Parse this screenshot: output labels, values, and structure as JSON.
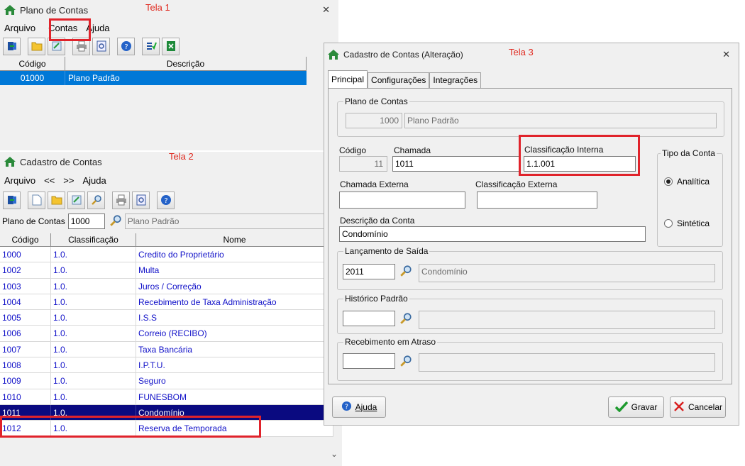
{
  "tela1": {
    "title": "Plano de Contas",
    "label": "Tela 1",
    "close": "✕",
    "menu": [
      "Arquivo",
      "Contas",
      "Ajuda"
    ],
    "columns": [
      "Código",
      "Descrição"
    ],
    "rows": [
      {
        "codigo": "01000",
        "descricao": "Plano Padrão"
      }
    ]
  },
  "tela2": {
    "title": "Cadastro de Contas",
    "label": "Tela 2",
    "menu": [
      "Arquivo",
      "<<",
      ">>",
      "Ajuda"
    ],
    "plano_label": "Plano de Contas",
    "plano_value": "1000",
    "plano_name": "Plano Padrão",
    "columns": [
      "Código",
      "Classificação",
      "Nome"
    ],
    "rows": [
      {
        "codigo": "1000",
        "classificacao": "1.0.",
        "nome": "Credito do Proprietário"
      },
      {
        "codigo": "1002",
        "classificacao": "1.0.",
        "nome": "Multa"
      },
      {
        "codigo": "1003",
        "classificacao": "1.0.",
        "nome": "Juros / Correção"
      },
      {
        "codigo": "1004",
        "classificacao": "1.0.",
        "nome": "Recebimento de Taxa Administração"
      },
      {
        "codigo": "1005",
        "classificacao": "1.0.",
        "nome": "I.S.S"
      },
      {
        "codigo": "1006",
        "classificacao": "1.0.",
        "nome": "Correio (RECIBO)"
      },
      {
        "codigo": "1007",
        "classificacao": "1.0.",
        "nome": "Taxa Bancária"
      },
      {
        "codigo": "1008",
        "classificacao": "1.0.",
        "nome": "I.P.T.U."
      },
      {
        "codigo": "1009",
        "classificacao": "1.0.",
        "nome": "Seguro"
      },
      {
        "codigo": "1010",
        "classificacao": "1.0.",
        "nome": "FUNESBOM"
      },
      {
        "codigo": "1011",
        "classificacao": "1.0.",
        "nome": "Condomínio"
      },
      {
        "codigo": "1012",
        "classificacao": "1.0.",
        "nome": "Reserva de Temporada"
      }
    ],
    "selected_index": 10
  },
  "tela3": {
    "title": "Cadastro de Contas (Alteração)",
    "label": "Tela 3",
    "close": "✕",
    "tabs": [
      "Principal",
      "Configurações",
      "Integrações"
    ],
    "plano_group": "Plano de Contas",
    "plano_num": "1000",
    "plano_name": "Plano Padrão",
    "codigo_label": "Código",
    "codigo_value": "11",
    "chamada_label": "Chamada",
    "chamada_value": "1011",
    "classif_interna_label": "Classificação Interna",
    "classif_interna_value": "1.1.001",
    "tipo_group": "Tipo da Conta",
    "tipo_options": [
      "Analítica",
      "Sintética"
    ],
    "tipo_selected": "Analítica",
    "chamada_externa_label": "Chamada Externa",
    "chamada_externa_value": "",
    "classif_externa_label": "Classificação Externa",
    "classif_externa_value": "",
    "descricao_label": "Descrição da Conta",
    "descricao_value": "Condomínio",
    "lancamento_group": "Lançamento de Saída",
    "lancamento_code": "2011",
    "lancamento_name": "Condomínio",
    "historico_group": "Histórico Padrão",
    "historico_code": "",
    "historico_name": "",
    "atraso_group": "Recebimento em Atraso",
    "atraso_code": "",
    "atraso_name": "",
    "btn_ajuda": "Ajuda",
    "btn_gravar": "Gravar",
    "btn_cancelar": "Cancelar"
  },
  "colors": {
    "highlight_red": "#e0232b",
    "selection_blue": "#0078d7",
    "selection_navy": "#0a0a80",
    "link_blue": "#1010c8"
  }
}
